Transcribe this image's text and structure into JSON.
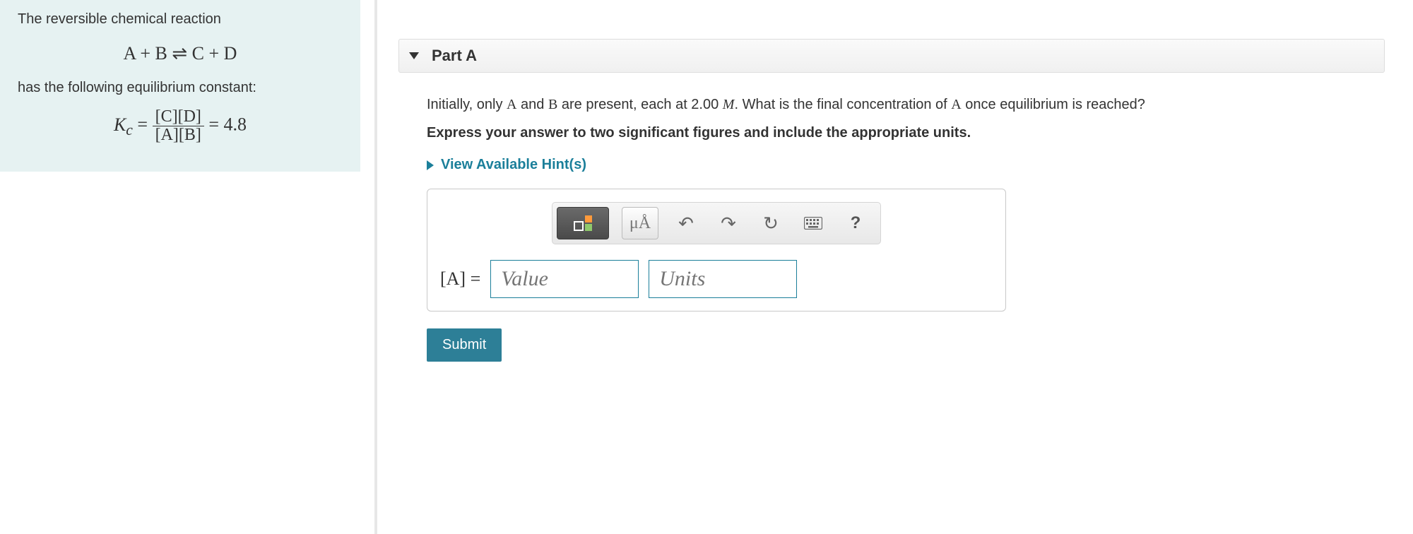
{
  "problem": {
    "intro": "The reversible chemical reaction",
    "reaction": "A + B ⇌ C + D",
    "kc_intro": "has the following equilibrium constant:",
    "kc_lhs": "K",
    "kc_sub": "c",
    "kc_eq": " = ",
    "kc_num": "[C][D]",
    "kc_den": "[A][B]",
    "kc_val": " = 4.8"
  },
  "part": {
    "label": "Part A",
    "question_pre": "Initially, only ",
    "q_A": "A",
    "q_and": " and ",
    "q_B": "B",
    "q_mid": " are present, each at 2.00 ",
    "q_M": "M",
    "q_post1": ". What is the final concentration of ",
    "q_A2": "A",
    "q_post2": " once equilibrium is reached?",
    "instruction": "Express your answer to two significant figures and include the appropriate units.",
    "hints_label": "View Available Hint(s)"
  },
  "toolbar": {
    "mu_label": "μÅ",
    "help": "?"
  },
  "answer": {
    "label": "[A] = ",
    "value_placeholder": "Value",
    "units_placeholder": "Units"
  },
  "buttons": {
    "submit": "Submit"
  }
}
